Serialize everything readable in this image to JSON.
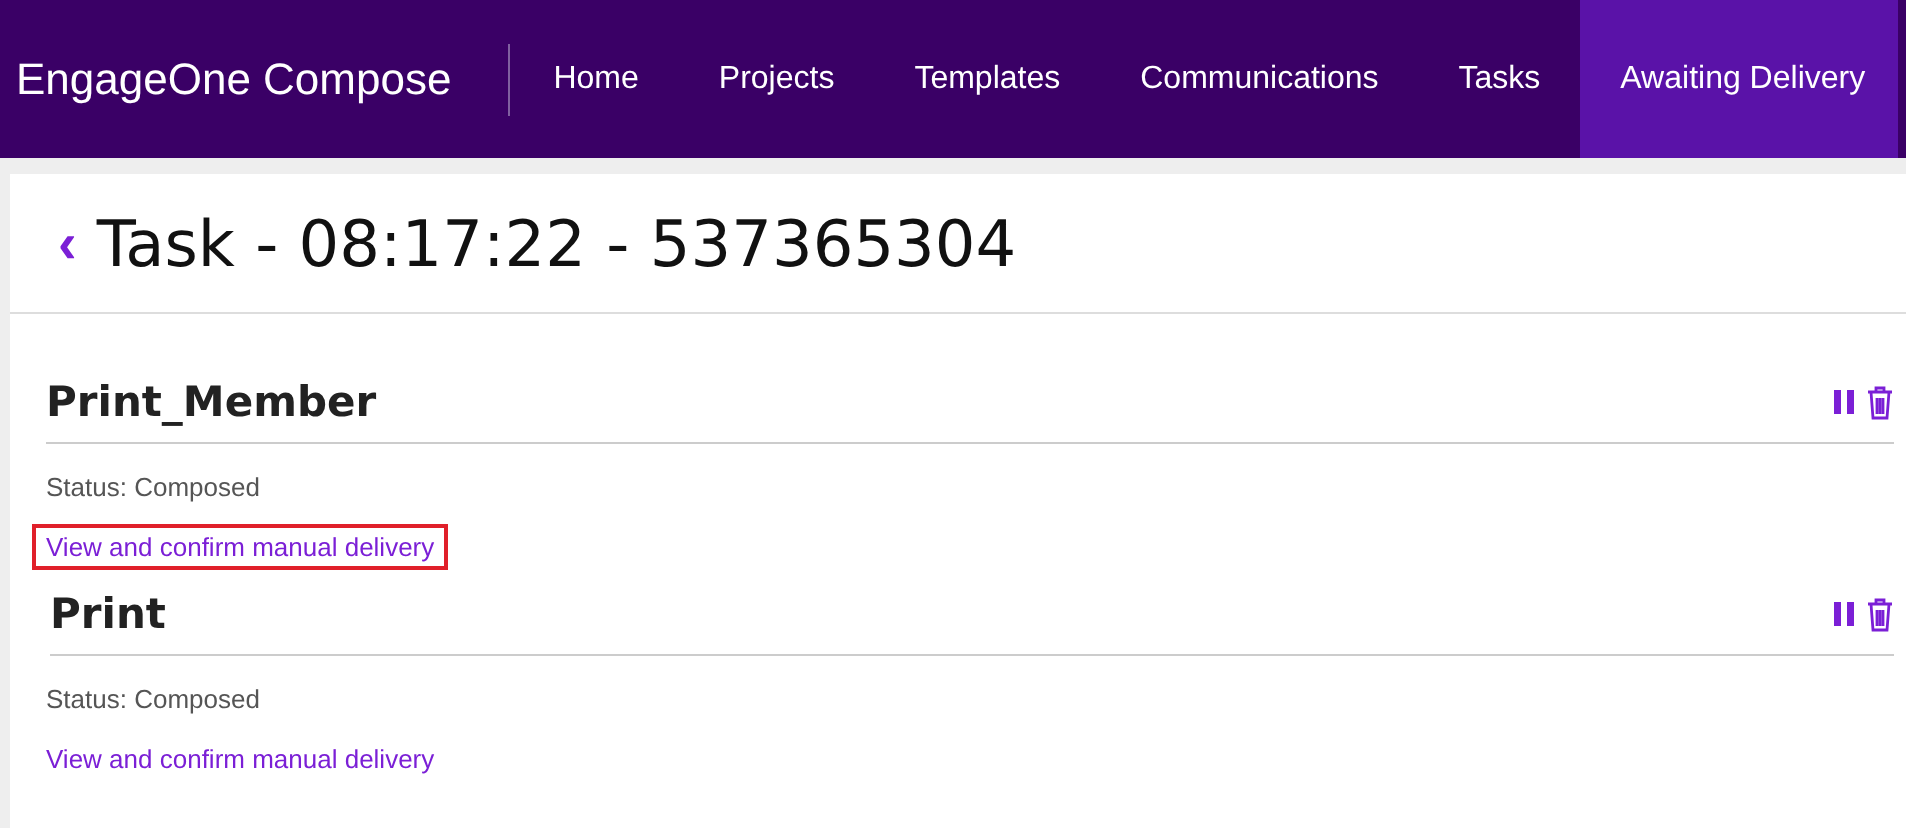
{
  "app": {
    "title": "EngageOne Compose"
  },
  "nav": [
    {
      "label": "Home",
      "selected": false
    },
    {
      "label": "Projects",
      "selected": false
    },
    {
      "label": "Templates",
      "selected": false
    },
    {
      "label": "Communications",
      "selected": false
    },
    {
      "label": "Tasks",
      "selected": false
    },
    {
      "label": "Awaiting Delivery",
      "selected": true
    }
  ],
  "page": {
    "back": "‹",
    "title": "Task - 08:17:22 - 537365304"
  },
  "items": [
    {
      "name": "Print_Member",
      "status": "Status: Composed",
      "link": "View and confirm manual delivery",
      "highlighted": true
    },
    {
      "name": "Print",
      "status": "Status: Composed",
      "link": "View and confirm manual delivery",
      "highlighted": false
    }
  ]
}
